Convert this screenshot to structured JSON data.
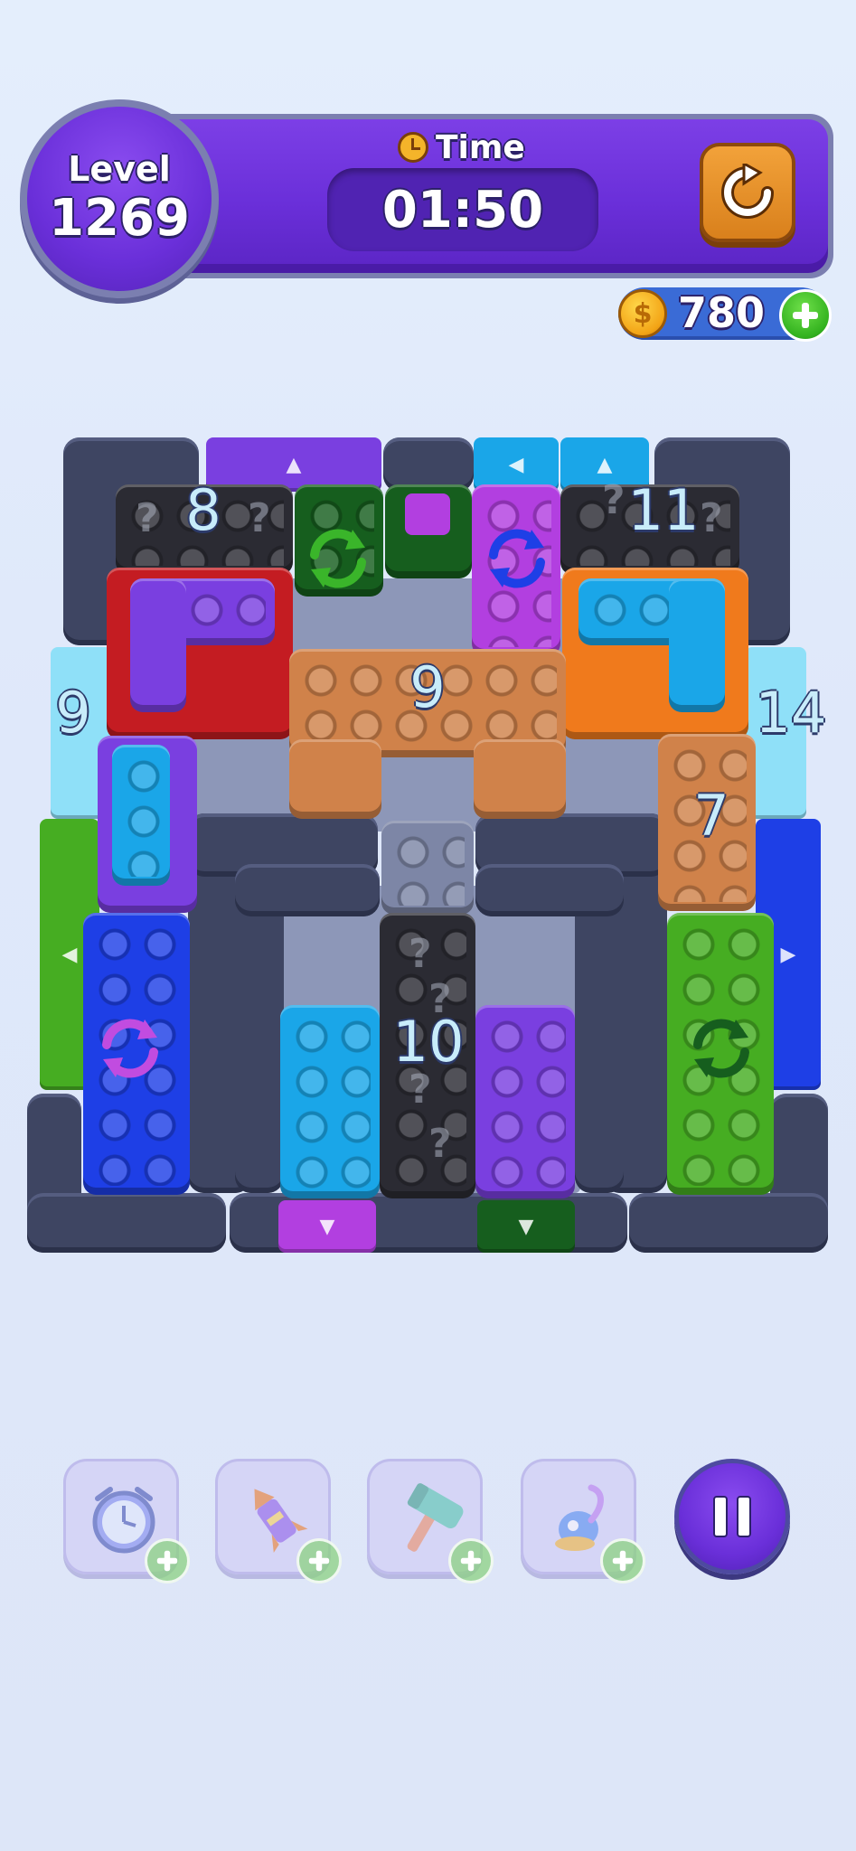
{
  "hud": {
    "level_label": "Level",
    "level_value": "1269",
    "time_label": "Time",
    "time_value": "01:50",
    "restart_icon": "restart-icon",
    "coins": "780",
    "coin_icon": "coin-icon",
    "add_coins_icon": "plus-icon"
  },
  "board": {
    "counters": {
      "top_left_black": "8",
      "top_right_black": "11",
      "left_ice": "9",
      "right_ice": "14",
      "orange_u": "9",
      "orange_right": "7",
      "center_black": "10"
    },
    "colors": {
      "wall": "#3e4562",
      "floor": "#8d97b8",
      "purple": "#7a3fe0",
      "black": "#2b2b33",
      "dark_green": "#165e1e",
      "magenta": "#b23fe0",
      "cyan": "#1aa6e8",
      "red": "#c41c22",
      "orange": "#f07a1c",
      "tan": "#d0824a",
      "blue": "#1e3fe6",
      "green": "#46ad22",
      "ice": "#8fe0f8"
    }
  },
  "boosters": [
    {
      "name": "freeze-clock-icon"
    },
    {
      "name": "rocket-icon"
    },
    {
      "name": "hammer-icon"
    },
    {
      "name": "vacuum-icon"
    }
  ],
  "pause_icon": "pause-icon"
}
